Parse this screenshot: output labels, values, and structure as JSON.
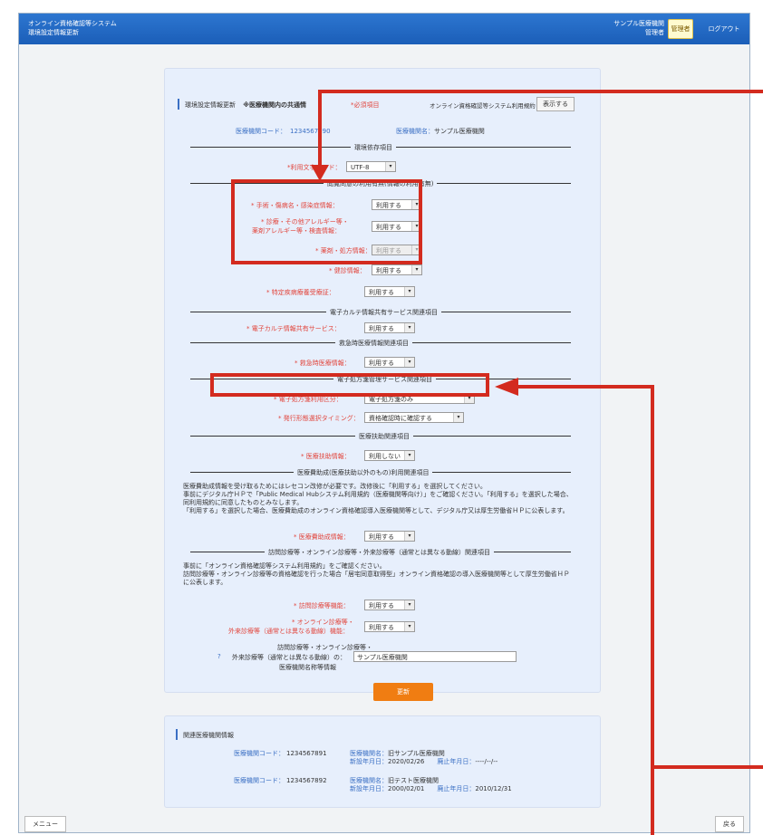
{
  "header": {
    "app_title_1": "オンライン資格確認等システム",
    "app_title_2": "環境設定情報更新",
    "org_name": "サンプル医療機関",
    "org_role": "管理者",
    "admin_badge": "管理者",
    "logout_label": "ログアウト"
  },
  "main": {
    "heading": "環境設定情報更新",
    "heading_note": "※医療機関内の共通情",
    "required_note": "*必須項目",
    "terms_label": "オンライン資格確認等システム利用規約",
    "show_button": "表示する",
    "facility_code_label": "医療機関コード：",
    "facility_code_value": "1234567890",
    "facility_name_label": "医療機関名：",
    "facility_name_value": "サンプル医療機関",
    "sections": {
      "env": "環境依存項目",
      "browse": "閲覧同意の利用有無(情報の利用有無)",
      "ekarte": "電子カルテ情報共有サービス関連項目",
      "emergency": "救急時医療情報関連項目",
      "eprescription": "電子処方箋管理サービス関連項目",
      "aid": "医療扶助関連項目",
      "subsidy": "医療費助成(医療扶助以外のもの)利用関連項目",
      "visit": "訪問診療等・オンライン診療等・外来診療等（通常とは異なる動線）関連項目"
    },
    "fields": {
      "charset_label": "*利用文字コード：",
      "charset_value": "UTF-8",
      "surgery_label": "* 手術・傷病名・感染症情報：",
      "surgery_value": "利用する",
      "allergy_label_1": "* 診療・その他アレルギー等・",
      "allergy_label_2": "薬剤アレルギー等・検査情報：",
      "allergy_value": "利用する",
      "drug_label": "* 薬剤・処方情報：",
      "drug_value": "利用する",
      "checkup_label": "* 健診情報：",
      "checkup_value": "利用する",
      "specific_label": "* 特定疾病療養受療証：",
      "specific_value": "利用する",
      "ekarte_label": "* 電子カルテ情報共有サービス：",
      "ekarte_value": "利用する",
      "emergency_label": "* 救急時医療情報：",
      "emergency_value": "利用する",
      "eprescription_label": "* 電子処方箋利用区分：",
      "eprescription_value": "電子処方箋のみ",
      "timing_label": "* 発行形態選択タイミング：",
      "timing_value": "資格確認時に確認する",
      "aid_label": "* 医療扶助情報：",
      "aid_value": "利用しない",
      "subsidy_label": "* 医療費助成情報：",
      "subsidy_value": "利用する",
      "visit_label": "* 訪問診療等機能：",
      "visit_value": "利用する",
      "online_label_1": "* オンライン診療等・",
      "online_label_2": "外来診療等（通常とは異なる動線）機能：",
      "online_value": "利用する",
      "name_label_1": "訪問診療等・オンライン診療等・",
      "name_label_2": "外来診療等（通常とは異なる動線）の：",
      "name_label_3": "医療機関名称等情報",
      "name_value": "サンプル医療機関",
      "help_mark": "?"
    },
    "subsidy_notes": [
      "医療費助成情報を受け取るためにはレセコン改修が必要です。改修後に「利用する」を選択してください。",
      "事前にデジタル庁ＨＰで「Public Medical Hubシステム利用規約（医療機関等向け）」をご確認ください。「利用する」を選択した場合、",
      "同利用規約に同意したものとみなします。",
      "「利用する」を選択した場合、医療費助成のオンライン資格確認導入医療機関等として、デジタル庁又は厚生労働省ＨＰに公表します。"
    ],
    "visit_notes": [
      "事前に「オンライン資格確認等システム利用規約」をご確認ください。",
      "訪問診療等・オンライン診療等の資格確認を行った場合「居宅同意取得型」オンライン資格確認の導入医療機関等として厚生労働省ＨＰ",
      "に公表します。"
    ],
    "update_button": "更新"
  },
  "related": {
    "title": "関連医療機関情報",
    "items": [
      {
        "code_label": "医療機関コード：",
        "code": "1234567891",
        "name_label": "医療機関名：",
        "name": "旧サンプル医療機関",
        "start_label": "新設年月日：",
        "start": "2020/02/26",
        "end_label": "廃止年月日：",
        "end": "----/--/--"
      },
      {
        "code_label": "医療機関コード：",
        "code": "1234567892",
        "name_label": "医療機関名：",
        "name": "旧テスト医療機関",
        "start_label": "新設年月日：",
        "start": "2000/02/01",
        "end_label": "廃止年月日：",
        "end": "2010/12/31"
      }
    ]
  },
  "footer": {
    "menu_label": "メニュー",
    "back_label": "戻る"
  },
  "colors": {
    "header_blue": "#1b5eb8",
    "highlight_red": "#d32b1f",
    "update_orange": "#f07d12",
    "required_red": "#e2463d"
  }
}
